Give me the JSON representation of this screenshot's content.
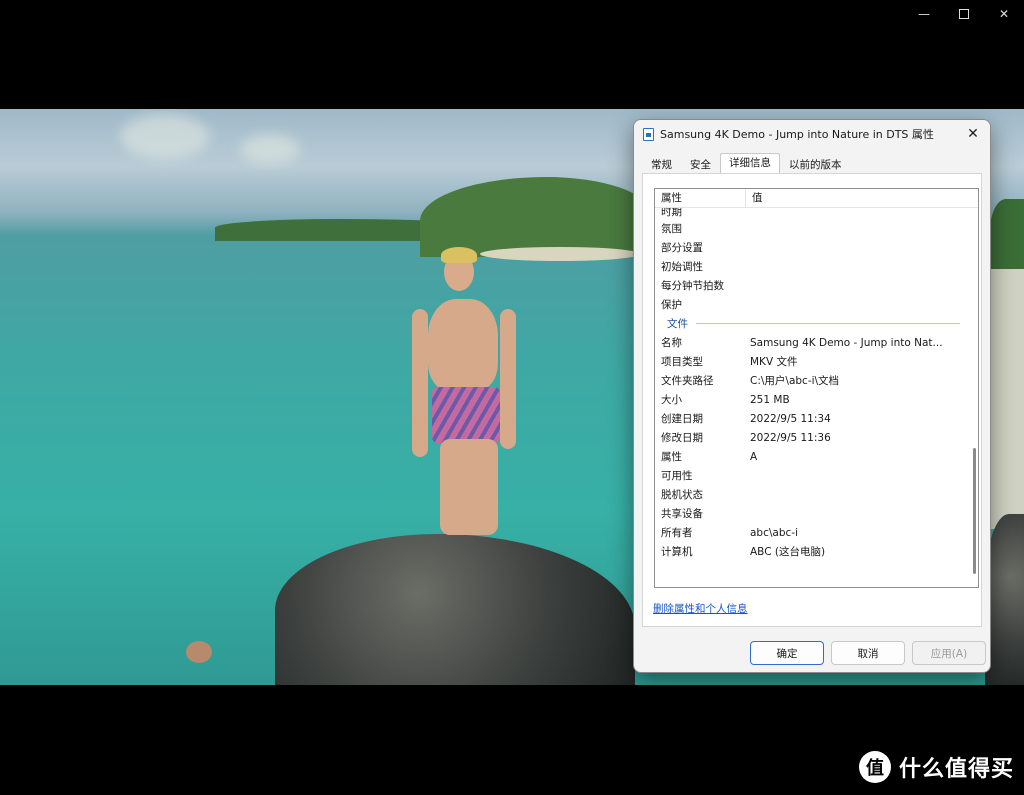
{
  "window_controls": {
    "minimize": "—",
    "close": "✕"
  },
  "dialog": {
    "title": "Samsung 4K Demo - Jump into Nature in DTS 属性",
    "close": "✕",
    "tabs": [
      "常规",
      "安全",
      "详细信息",
      "以前的版本"
    ],
    "active_tab": "详细信息",
    "list_header": {
      "name": "属性",
      "value": "值"
    },
    "cut_row": "时期",
    "rows_top": [
      {
        "k": "氛围",
        "v": ""
      },
      {
        "k": "部分设置",
        "v": ""
      },
      {
        "k": "初始调性",
        "v": ""
      },
      {
        "k": "每分钟节拍数",
        "v": ""
      },
      {
        "k": "保护",
        "v": ""
      }
    ],
    "section_file": "文件",
    "rows_file": [
      {
        "k": "名称",
        "v": "Samsung 4K Demo - Jump into Nat..."
      },
      {
        "k": "项目类型",
        "v": "MKV 文件"
      },
      {
        "k": "文件夹路径",
        "v": "C:\\用户\\abc-i\\文档"
      },
      {
        "k": "大小",
        "v": "251 MB"
      },
      {
        "k": "创建日期",
        "v": "2022/9/5 11:34"
      },
      {
        "k": "修改日期",
        "v": "2022/9/5 11:36"
      },
      {
        "k": "属性",
        "v": "A"
      },
      {
        "k": "可用性",
        "v": ""
      },
      {
        "k": "脱机状态",
        "v": ""
      },
      {
        "k": "共享设备",
        "v": ""
      },
      {
        "k": "所有者",
        "v": "abc\\abc-i"
      },
      {
        "k": "计算机",
        "v": "ABC (这台电脑)"
      }
    ],
    "remove_link": "删除属性和个人信息",
    "buttons": {
      "ok": "确定",
      "cancel": "取消",
      "apply": "应用(A)"
    }
  },
  "watermark": {
    "logo": "值",
    "text": "什么值得买"
  }
}
